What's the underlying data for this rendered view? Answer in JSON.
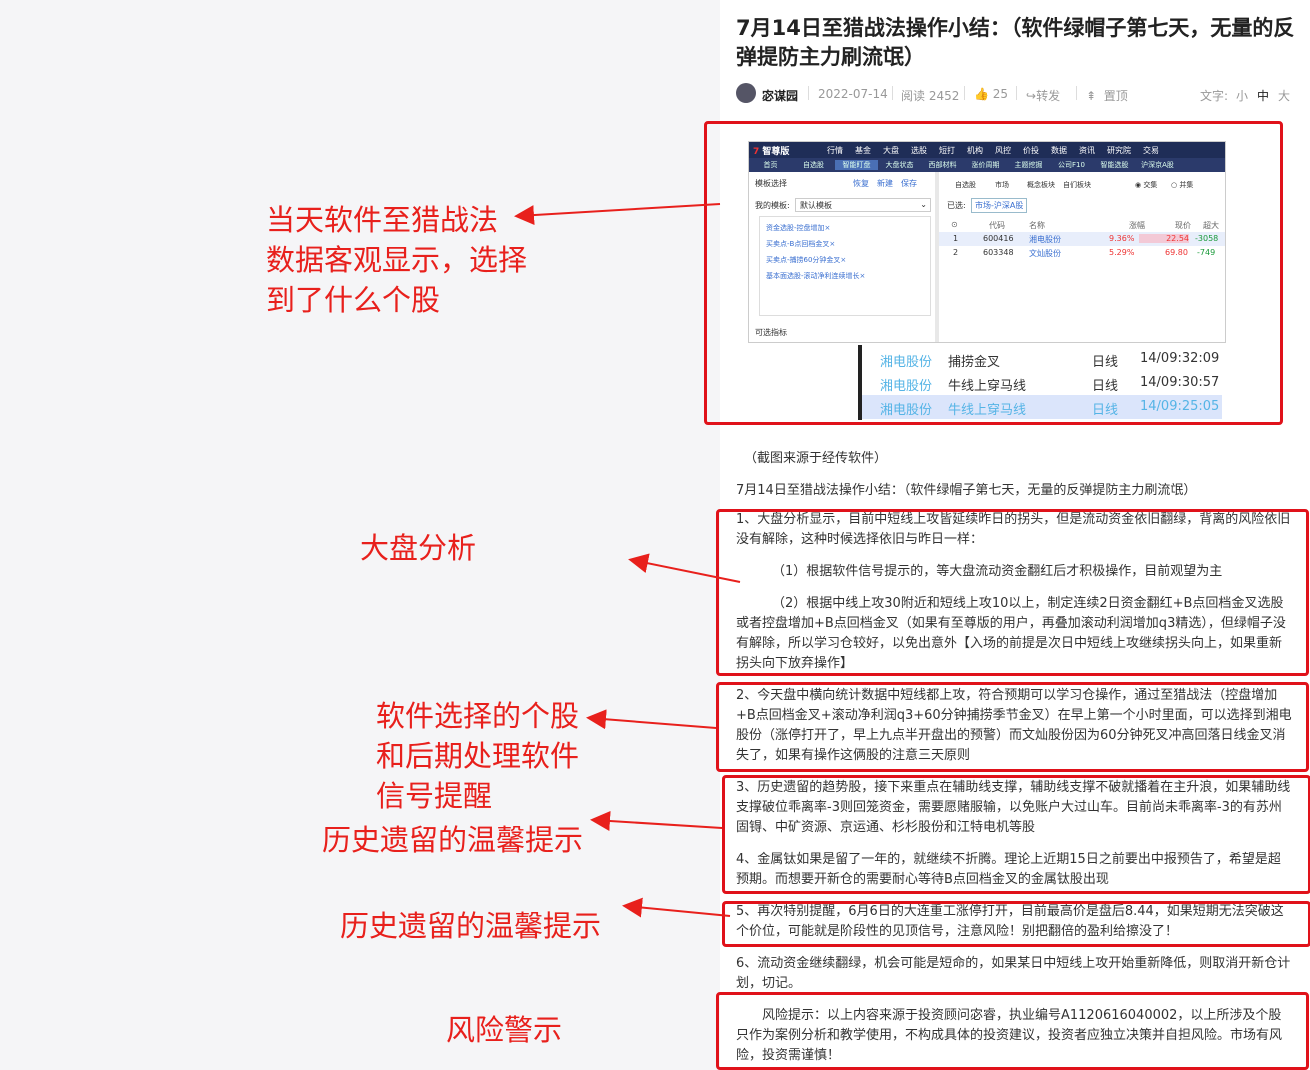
{
  "article": {
    "title": "7月14日至猎战法操作小结：（软件绿帽子第七天，无量的反弹提防主力刷流氓）",
    "author": "宓谋园",
    "date": "2022-07-14",
    "reads": "阅读 2452",
    "likes": "25",
    "share_label": "转发",
    "top_label": "置顶",
    "font_size_label": "文字:",
    "font_small": "小",
    "font_medium": "中",
    "font_large": "大",
    "screenshot_caption": "（截图来源于经传软件）",
    "subtitle": "7月14日至猎战法操作小结：（软件绿帽子第七天，无量的反弹提防主力刷流氓）",
    "p1": "1、大盘分析显示，目前中短线上攻皆延续昨日的拐头，但是流动资金依旧翻绿，背离的风险依旧没有解除，这种时候选择依旧与昨日一样：",
    "p1a": "（1）根据软件信号提示的，等大盘流动资金翻红后才积极操作，目前观望为主",
    "p1b": "（2）根据中线上攻30附近和短线上攻10以上，制定连续2日资金翻红+B点回档金叉选股或者控盘增加+B点回档金叉（如果有至尊版的用户，再叠加滚动利润增加q3精选），但绿帽子没有解除，所以学习仓较好，以免出意外【入场的前提是次日中短线上攻继续拐头向上，如果重新拐头向下放弃操作】",
    "p2": "2、今天盘中横向统计数据中短线都上攻，符合预期可以学习仓操作，通过至猎战法（控盘增加+B点回档金叉+滚动净利润q3+60分钟捕捞季节金叉）在早上第一个小时里面，可以选择到湘电股份（涨停打开了，早上九点半开盘出的预警）而文灿股份因为60分钟死叉冲高回落日线金叉消失了，如果有操作这俩股的注意三天原则",
    "p3": "3、历史遗留的趋势股，接下来重点在辅助线支撑，辅助线支撑不破就播着在主升浪，如果辅助线支撑破位乖离率-3则回笼资金，需要愿赌服输，以免账户大过山车。目前尚未乖离率-3的有苏州固锝、中矿资源、京运通、杉杉股份和江特电机等股",
    "p4": "4、金属钛如果是留了一年的，就继续不折腾。理论上近期15日之前要出中报预告了，希望是超预期。而想要开新仓的需要耐心等待B点回档金叉的金属钛股出现",
    "p5": "5、再次特别提醒，6月6日的大连重工涨停打开，目前最高价是盘后8.44，如果短期无法突破这个价位，可能就是阶段性的见顶信号，注意风险！别把翻倍的盈利给擦没了！",
    "p6": "6、流动资金继续翻绿，机会可能是短命的，如果某日中短线上攻开始重新降低，则取消开新仓计划，切记。",
    "risk": "风险提示：以上内容来源于投资顾问宓睿，执业编号A1120616040002，以上所涉及个股只作为案例分析和教学使用，不构成具体的投资建议，投资者应独立决策并自担风险。市场有风险，投资需谨慎！"
  },
  "annotations": {
    "a1_line1": "当天软件至猎战法",
    "a1_line2": "数据客观显示，选择",
    "a1_line3": "到了什么个股",
    "a2": "大盘分析",
    "a3_line1": "软件选择的个股",
    "a3_line2": "和后期处理软件",
    "a3_line3": "信号提醒",
    "a4": "历史遗留的温馨提示",
    "a5": "历史遗留的温馨提示",
    "a6": "风险警示"
  },
  "software": {
    "logo": "智尊版",
    "menu": [
      "行情",
      "基金",
      "大盘",
      "选股",
      "短打",
      "机构",
      "风控",
      "价投",
      "数据",
      "资讯",
      "研究院",
      "交易"
    ],
    "tabs": [
      "首页",
      "自选股",
      "智能盯盘",
      "大盘状态",
      "西部材料",
      "涨价周期",
      "主题挖掘",
      "公司F10",
      "智能选股",
      "沪深京A股"
    ],
    "left_header": "模板选择",
    "left_links": [
      "恢复",
      "新建",
      "保存"
    ],
    "my_template_label": "我的模板:",
    "template_value": "默认模板",
    "templates": [
      "资金选股-控盘增加×",
      "买卖点-B点回档金叉×",
      "买卖点-捕捞60分钟金叉×",
      "基本面选股-滚动净利连续增长×"
    ],
    "optional_label": "可选指标",
    "right_tabs": [
      "自选股",
      "市场",
      "概念板块",
      "自们板块"
    ],
    "radio_intersect": "交集",
    "radio_union": "并集",
    "selected_label": "已选:",
    "selected_value": "市场-沪深A股",
    "columns": [
      "代码",
      "名称",
      "涨幅",
      "现价",
      "超大单"
    ],
    "rows": [
      {
        "idx": "1",
        "code": "600416",
        "name": "湘电股份",
        "change": "9.36%",
        "price": "22.54",
        "big": "-3058"
      },
      {
        "idx": "2",
        "code": "603348",
        "name": "文灿股份",
        "change": "5.29%",
        "price": "69.80",
        "big": "-749"
      }
    ],
    "signals": [
      {
        "stock": "湘电股份",
        "signal": "捕捞金叉",
        "period": "日线",
        "time": "14/09:32:09"
      },
      {
        "stock": "湘电股份",
        "signal": "牛线上穿马线",
        "period": "日线",
        "time": "14/09:30:57"
      },
      {
        "stock": "湘电股份",
        "signal": "牛线上穿马线",
        "period": "日线",
        "time": "14/09:25:05"
      }
    ]
  }
}
